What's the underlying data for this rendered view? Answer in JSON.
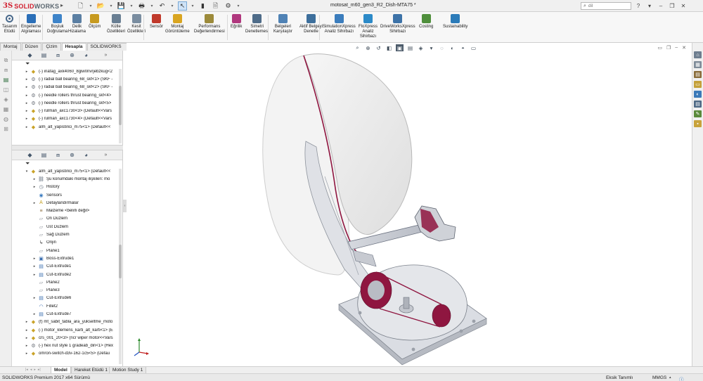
{
  "app": {
    "logo_mark": "3S",
    "logo_solid": "SOLID",
    "logo_works": "WORKS",
    "document_title": "motosat_m60_gen3_R2_Dish-MTA75 *",
    "search_placeholder": "dil"
  },
  "toolbar_left": {
    "label_line1": "Tasarım",
    "label_line2": "Etüdü"
  },
  "commands": [
    {
      "l1": "Engelleme",
      "l2": "Algılaması",
      "color": "#2b6fb8"
    },
    {
      "l1": "Boşluk",
      "l2": "Doğrulama",
      "color": "#3e84c9"
    },
    {
      "l1": "Delik",
      "l2": "Hizalama",
      "color": "#5b7fa3"
    },
    {
      "l1": "Ölçüm",
      "l2": "",
      "color": "#c79a1f"
    },
    {
      "l1": "Kütle",
      "l2": "Özellikleri",
      "color": "#6a7f93"
    },
    {
      "l1": "Kesit",
      "l2": "Özellikleri",
      "color": "#7a8da0"
    },
    {
      "l1": "Sensör",
      "l2": "",
      "color": "#c0392b"
    },
    {
      "l1": "Montaj",
      "l2": "Görüntüleme",
      "color": "#d9a521"
    },
    {
      "l1": "Performans",
      "l2": "Değerlendirmesi",
      "color": "#9c8a3a"
    },
    {
      "l1": "Eğrilik",
      "l2": "",
      "color": "#b0387e"
    },
    {
      "l1": "Simetri",
      "l2": "Denetlemesi",
      "color": "#4f6c89"
    },
    {
      "l1": "Belgeleri",
      "l2": "Karşılaştır",
      "color": "#4f82b5"
    },
    {
      "l1": "Aktif Belgeyi",
      "l2": "Denetle",
      "color": "#3d6f9c"
    },
    {
      "l1": "SimulationXpress",
      "l2": "Analiz Sihirbazı",
      "color": "#3b7dbd"
    },
    {
      "l1": "FloXpress",
      "l2": "Analiz",
      "l3": "Sihirbazı",
      "color": "#2c8ac8"
    },
    {
      "l1": "DriveWorksXpress",
      "l2": "Sihirbazı",
      "color": "#3d73a8"
    },
    {
      "l1": "Costing",
      "l2": "",
      "color": "#4f8f3c"
    },
    {
      "l1": "Sustainability",
      "l2": "",
      "color": "#2b7bb9"
    }
  ],
  "tabs": [
    "Montaj",
    "Düzen",
    "Çizim",
    "Hesapla",
    "SOLIDWORKS Eklentileri"
  ],
  "top_tree": [
    {
      "label": "(-) inafag_axk4060_8giw0nvrjebzkug<2",
      "icon": "part"
    },
    {
      "label": "(-) radial ball bearing_68_skf<1> (SKF -",
      "icon": "bearing"
    },
    {
      "label": "(-) radial ball bearing_68_skf<2> (SKF -",
      "icon": "bearing"
    },
    {
      "label": "(-) needle rollers thrust bearing_skf<4>",
      "icon": "bearing"
    },
    {
      "label": "(-) needle rollers thrust bearing_skf<5>",
      "icon": "bearing"
    },
    {
      "label": "(-) rulman_axc1730<3> (Default<<Vars",
      "icon": "part"
    },
    {
      "label": "(-) rulman_axc1730<4> (Default<<Vars",
      "icon": "part"
    },
    {
      "label": "alm_alt_yapistirici_m75<1> (Default<<",
      "icon": "part"
    }
  ],
  "bottom_tree": [
    {
      "label": "alm_alt_yapistirici_m75<1> (Default<<",
      "icon": "part",
      "lvl": 0,
      "exp": "▾"
    },
    {
      "label": "Şu konumdaki montaj ilişkileri: mo",
      "icon": "mates",
      "lvl": 1,
      "exp": "▸"
    },
    {
      "label": "History",
      "icon": "history",
      "lvl": 1,
      "exp": "▸"
    },
    {
      "label": "Sensors",
      "icon": "sensor",
      "lvl": 1,
      "exp": ""
    },
    {
      "label": "Detaylandırmalar",
      "icon": "annot",
      "lvl": 1,
      "exp": "▸"
    },
    {
      "label": "Malzeme <belirli değil>",
      "icon": "material",
      "lvl": 1,
      "exp": ""
    },
    {
      "label": "Ön Düzlem",
      "icon": "plane",
      "lvl": 1,
      "exp": ""
    },
    {
      "label": "Üst Düzlem",
      "icon": "plane",
      "lvl": 1,
      "exp": ""
    },
    {
      "label": "Sağ Düzlem",
      "icon": "plane",
      "lvl": 1,
      "exp": ""
    },
    {
      "label": "Orijin",
      "icon": "origin",
      "lvl": 1,
      "exp": ""
    },
    {
      "label": "Plane1",
      "icon": "plane",
      "lvl": 1,
      "exp": ""
    },
    {
      "label": "Boss-Extrude1",
      "icon": "boss",
      "lvl": 1,
      "exp": "▸"
    },
    {
      "label": "Cut-Extrude1",
      "icon": "cut",
      "lvl": 1,
      "exp": "▸"
    },
    {
      "label": "Cut-Extrude2",
      "icon": "cut",
      "lvl": 1,
      "exp": "▸"
    },
    {
      "label": "Plane2",
      "icon": "plane",
      "lvl": 1,
      "exp": ""
    },
    {
      "label": "Plane3",
      "icon": "plane",
      "lvl": 1,
      "exp": ""
    },
    {
      "label": "Cut-Extrude6",
      "icon": "cut",
      "lvl": 1,
      "exp": "▸"
    },
    {
      "label": "Fillet2",
      "icon": "fillet",
      "lvl": 1,
      "exp": ""
    },
    {
      "label": "Cut-Extrude7",
      "icon": "cut",
      "lvl": 1,
      "exp": "▸"
    },
    {
      "label": "(f) mt_sabit_tabla_ara_yukseltme_moto",
      "icon": "part",
      "lvl": 0,
      "exp": "▸"
    },
    {
      "label": "(-) motor_klemens_karti_alt_karti<1> (E",
      "icon": "part",
      "lvl": 0,
      "exp": "▸"
    },
    {
      "label": "crs_001_20<3> (ncr wiper motor<<Vars",
      "icon": "part",
      "lvl": 0,
      "exp": "▸"
    },
    {
      "label": "(-) hex nut style 1 gradeab_din<1> (Hex",
      "icon": "bearing",
      "lvl": 0,
      "exp": "▸"
    },
    {
      "label": "omron-switch-d3v-162-1c5<5> (Defau",
      "icon": "part",
      "lvl": 0,
      "exp": "▸"
    }
  ],
  "bottom_tabs": [
    "Model",
    "Hareket Etüdü 1",
    "Motion Study 1"
  ],
  "status": {
    "left": "SOLIDWORKS Premium 2017 x64 Sürümü",
    "definition": "Eksik Tanımlı",
    "units": "MMGS"
  },
  "icons": {
    "filter": "funnel-icon",
    "expand": "triangle-icon",
    "part": "part-icon",
    "bearing": "bearing-icon",
    "plane": "plane-icon"
  },
  "colors": {
    "accent_red": "#d11f2f",
    "section_magenta": "#8f1640",
    "selection_blue": "#cfe3f7"
  }
}
